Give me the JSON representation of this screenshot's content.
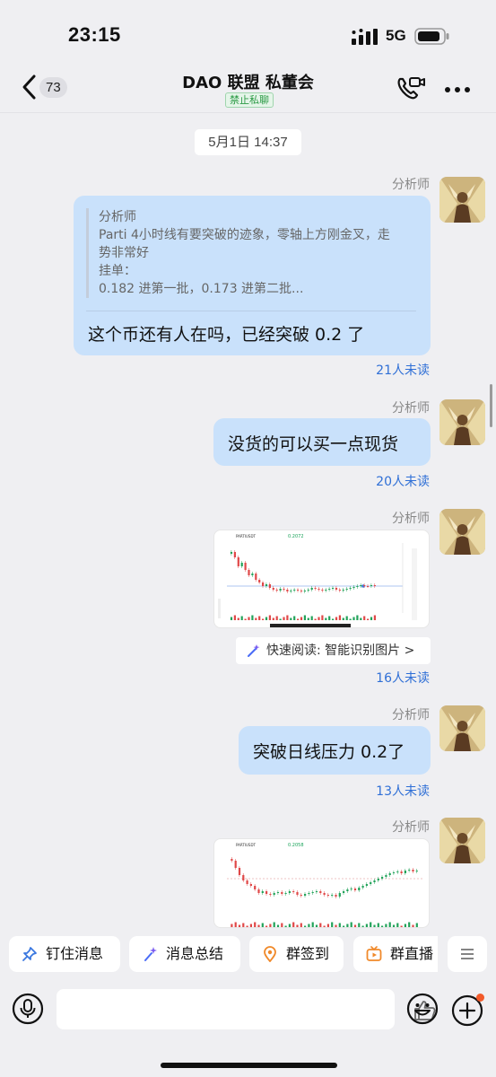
{
  "status_bar": {
    "time": "23:15",
    "network": "5G"
  },
  "header": {
    "back_count": "73",
    "title": "DAO 联盟 私董会",
    "badge": "禁止私聊"
  },
  "timestamp": "5月1日 14:37",
  "messages": [
    {
      "sender": "分析师",
      "quote_author": "分析师",
      "quote_lines": [
        "Parti 4小时线有要突破的迹象，零轴上方刚金叉，走",
        "势非常好",
        "挂单：",
        "0.182 进第一批，0.173 进第二批..."
      ],
      "text": "这个币还有人在吗，已经突破 0.2 了",
      "unread": "21人未读"
    },
    {
      "sender": "分析师",
      "text": "没货的可以买一点现货",
      "unread": "20人未读"
    },
    {
      "sender": "分析师",
      "image": "chart-screenshot",
      "chart_title": "PARTIUSDT",
      "chart_price": "0.2072",
      "quick_read": "快速阅读: 智能识别图片 >",
      "unread": "16人未读"
    },
    {
      "sender": "分析师",
      "text": "突破日线压力 0.2了",
      "unread": "13人未读"
    },
    {
      "sender": "分析师",
      "image": "chart-screenshot",
      "chart_title": "PARTIUSDT",
      "chart_price": "0.2058"
    }
  ],
  "quick_actions": [
    {
      "label": "钉住消息",
      "icon": "pin-icon"
    },
    {
      "label": "消息总结",
      "icon": "sparkle-icon"
    },
    {
      "label": "群签到",
      "icon": "location-checkin-icon"
    },
    {
      "label": "群直播",
      "icon": "live-tv-icon"
    }
  ],
  "colors": {
    "bubble": "#c9e1fb",
    "unread": "#2f6fd6",
    "badge_green": "#2a9a44",
    "background": "#efeff2",
    "notification_dot": "#f25a2a"
  }
}
